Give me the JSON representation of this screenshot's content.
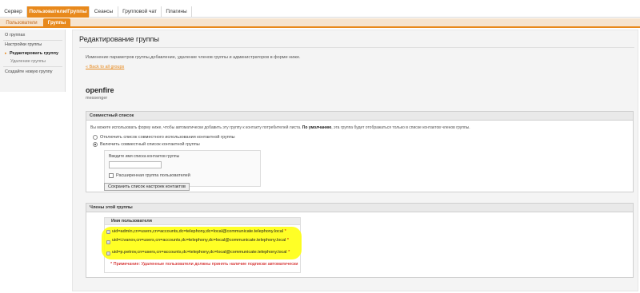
{
  "topnav": {
    "tabs": [
      {
        "label": "Сервер"
      },
      {
        "label": "Пользователи/Группы"
      },
      {
        "label": "Сеансы"
      },
      {
        "label": "Групповой чат"
      },
      {
        "label": "Плагины"
      }
    ]
  },
  "subnav": {
    "tabs": [
      {
        "label": "Пользователи"
      },
      {
        "label": "Группы"
      }
    ]
  },
  "sidebar": {
    "items": [
      {
        "label": "О группах"
      },
      {
        "label": "Настройки группы"
      },
      {
        "label": "Редактировать группу"
      },
      {
        "label": "Удаление группы"
      },
      {
        "label": "Создайте новую группу"
      }
    ]
  },
  "main": {
    "title": "Редактирование группы",
    "description": "Изменение параметров группы,добавление, удаление членов группы и администраторов в форме ниже.",
    "back_link": "« Back to all groups",
    "group_name": "openfire",
    "group_desc": "messenger"
  },
  "shared": {
    "header": "Совместный список",
    "intro_text": "Вы можете использовать форму ниже, чтобы автоматически добавить эту группу к контакту потребителей листа.",
    "intro_bold": "По умолчанию",
    "intro_tail": ", эта группа будет отображаться только в списке контактов членов группы.",
    "option_disable": "Отключить список совместного использования контактной группы",
    "option_enable": "Включить совместный список контактной группы",
    "input_label": "Введите имя списка контактов группы",
    "input_value": "",
    "checkbox_label": "Расширенная группа пользователей",
    "save_button": "Сохранить список настроек контактов"
  },
  "members": {
    "header": "Члены этой группы",
    "column_header": "Имя пользователя",
    "rows": [
      {
        "user": "uid=admin,cn=users,cn=accounts,dc=telephony,dc=local@communicate.telephony.local",
        "marker": "*"
      },
      {
        "user": "uid=i.ivanov,cn=users,cn=accounts,dc=telephony,dc=local@communicate.telephony.local",
        "marker": "*"
      },
      {
        "user": "uid=p.petrov,cn=users,cn=accounts,dc=telephony,dc=local@communicate.telephony.local",
        "marker": "*"
      }
    ],
    "note": "* Примечание: Удаленные пользователи должны принять наличие подписки автоматически"
  },
  "colors": {
    "accent": "#e8891c",
    "highlight": "#ffff00",
    "warning": "#cc0000"
  }
}
